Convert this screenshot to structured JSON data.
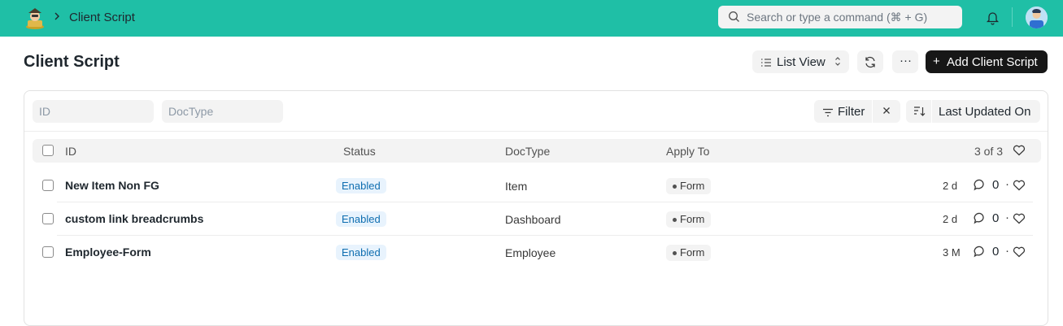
{
  "navbar": {
    "breadcrumb": "Client Script",
    "search_placeholder": "Search or type a command (⌘ + G)",
    "accent": "#1fbfa6"
  },
  "page": {
    "title": "Client Script",
    "view_label": "List View",
    "add_label": "Add Client Script"
  },
  "filters": {
    "id_placeholder": "ID",
    "doctype_placeholder": "DocType",
    "filter_label": "Filter",
    "sort_label": "Last Updated On"
  },
  "table": {
    "columns": [
      "ID",
      "Status",
      "DocType",
      "Apply To"
    ],
    "count": "3 of 3",
    "rows": [
      {
        "name": "New Item Non FG",
        "status": "Enabled",
        "doctype": "Item",
        "apply_to": "Form",
        "time": "2 d",
        "comments": "0"
      },
      {
        "name": "custom link breadcrumbs",
        "status": "Enabled",
        "doctype": "Dashboard",
        "apply_to": "Form",
        "time": "2 d",
        "comments": "0"
      },
      {
        "name": "Employee-Form",
        "status": "Enabled",
        "doctype": "Employee",
        "apply_to": "Form",
        "time": "3 M",
        "comments": "0"
      }
    ]
  },
  "icons": [
    "app-logo-icon",
    "chevron-right-icon",
    "search-icon",
    "bell-icon",
    "avatar",
    "list-icon",
    "up-down-icon",
    "refresh-icon",
    "more-icon",
    "plus-icon",
    "filter-icon",
    "close-icon",
    "sort-icon",
    "comment-icon",
    "heart-icon"
  ]
}
